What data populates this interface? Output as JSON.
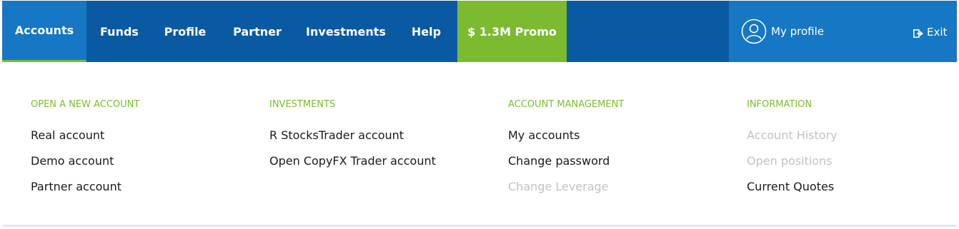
{
  "nav": {
    "items": [
      {
        "label": "Accounts"
      },
      {
        "label": "Funds"
      },
      {
        "label": "Profile"
      },
      {
        "label": "Partner"
      },
      {
        "label": "Investments"
      },
      {
        "label": "Help"
      },
      {
        "label": "$ 1.3M Promo"
      }
    ],
    "profile_label": "My profile",
    "exit_label": "Exit"
  },
  "menu": {
    "columns": [
      {
        "heading": "OPEN A NEW ACCOUNT",
        "links": [
          {
            "label": "Real account"
          },
          {
            "label": "Demo account"
          },
          {
            "label": "Partner account"
          }
        ]
      },
      {
        "heading": "INVESTMENTS",
        "links": [
          {
            "label": "R StocksTrader account"
          },
          {
            "label": "Open CopyFX Trader account"
          }
        ]
      },
      {
        "heading": "ACCOUNT MANAGEMENT",
        "links": [
          {
            "label": "My accounts"
          },
          {
            "label": "Change password"
          },
          {
            "label": "Change Leverage"
          }
        ]
      },
      {
        "heading": "INFORMATION",
        "links": [
          {
            "label": "Account History"
          },
          {
            "label": "Open positions"
          },
          {
            "label": "Current Quotes"
          }
        ]
      }
    ]
  },
  "colors": {
    "nav_bg": "#0a5aa3",
    "nav_active_bg": "#1677c4",
    "accent_green": "#7cbb2f",
    "disabled_text": "#c2c2c2"
  }
}
